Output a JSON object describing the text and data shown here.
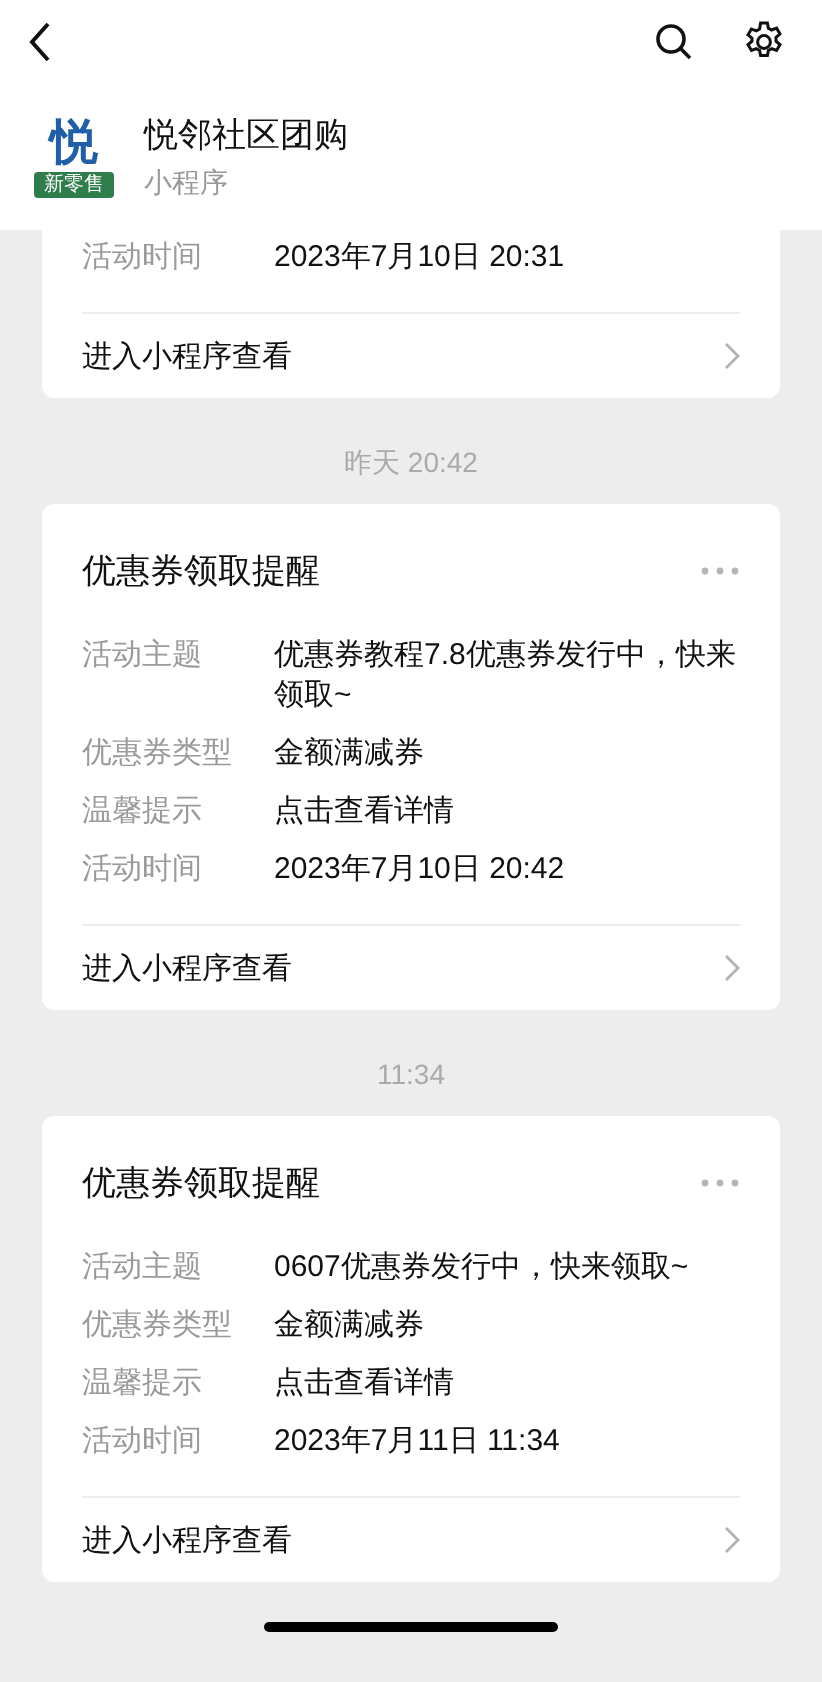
{
  "app": {
    "logo_mark": "悦",
    "logo_banner": "新零售",
    "name": "悦邻社区团购",
    "subtitle": "小程序"
  },
  "messages": [
    {
      "cut_top": true,
      "rows": [
        {
          "label": "活动时间",
          "value": "2023年7月10日 20:31"
        }
      ],
      "link": "进入小程序查看"
    },
    {
      "time": "昨天 20:42",
      "cut_top": false,
      "title": "优惠券领取提醒",
      "rows": [
        {
          "label": "活动主题",
          "value": "优惠券教程7.8优惠券发行中，快来领取~"
        },
        {
          "label": "优惠券类型",
          "value": "金额满减券"
        },
        {
          "label": "温馨提示",
          "value": "点击查看详情"
        },
        {
          "label": "活动时间",
          "value": "2023年7月10日 20:42"
        }
      ],
      "link": "进入小程序查看"
    },
    {
      "time": "11:34",
      "cut_top": false,
      "title": "优惠券领取提醒",
      "rows": [
        {
          "label": "活动主题",
          "value": "0607优惠券发行中，快来领取~"
        },
        {
          "label": "优惠券类型",
          "value": "金额满减券"
        },
        {
          "label": "温馨提示",
          "value": "点击查看详情"
        },
        {
          "label": "活动时间",
          "value": "2023年7月11日 11:34"
        }
      ],
      "link": "进入小程序查看"
    }
  ]
}
